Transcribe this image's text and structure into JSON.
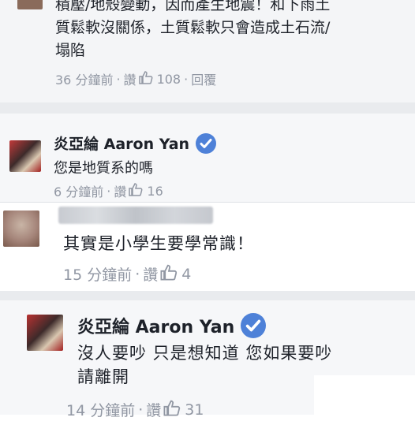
{
  "comments": [
    {
      "text_lines": [
        "積壓/地殼變動，因而產生地震！和下雨土",
        "質鬆軟沒關係，土質鬆軟只會造成土石流/",
        "塌陷"
      ],
      "time": "36 分鐘前",
      "sep": "·",
      "like": "讚",
      "likes": "108",
      "reply": "回覆"
    },
    {
      "author": "炎亞綸 Aaron Yan",
      "text": "您是地質系的嗎",
      "time": "6 分鐘前",
      "sep": "·",
      "like": "讚",
      "likes": "16"
    },
    {
      "text": "其實是小學生要學常識！",
      "time": "15 分鐘前",
      "sep": "·",
      "like": "讚",
      "likes": "4"
    },
    {
      "author": "炎亞綸 Aaron Yan",
      "text_lines": [
        "沒人要吵 只是想知道 您如果要吵",
        "請離開"
      ],
      "time": "14 分鐘前",
      "sep": "·",
      "like": "讚",
      "likes": "31"
    }
  ],
  "colors": {
    "verified_badge": "#4e81d8",
    "meta_text": "#9197a3",
    "body_text": "#1d2129"
  },
  "icons": [
    "verified-check-icon",
    "like-thumb-icon"
  ]
}
